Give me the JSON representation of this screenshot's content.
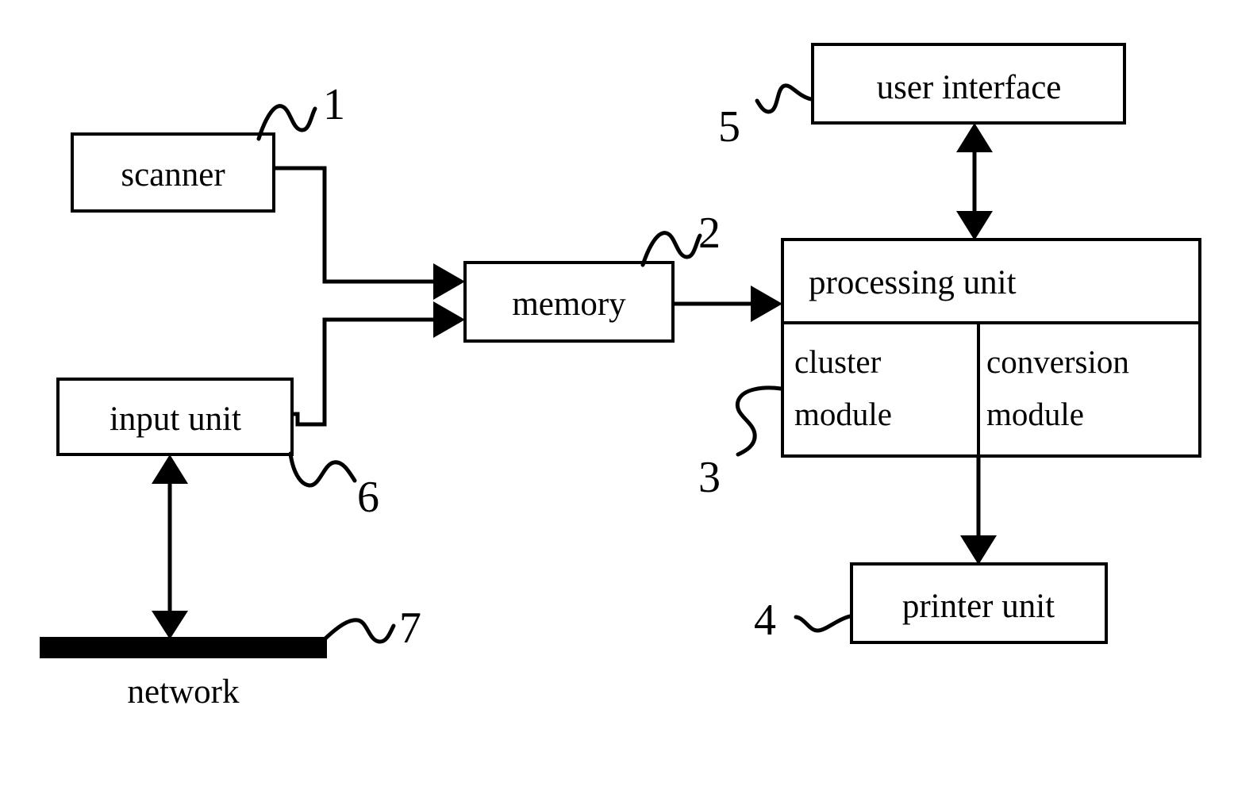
{
  "figure": {
    "type": "block-diagram",
    "title": "",
    "background_color": "#ffffff",
    "line_color": "#000000"
  },
  "blocks": {
    "scanner": {
      "label": "scanner",
      "ref": "1"
    },
    "memory": {
      "label": "memory",
      "ref": "2"
    },
    "input_unit": {
      "label": "input unit",
      "ref": "6"
    },
    "network": {
      "label": "network",
      "ref": "7"
    },
    "user_interface": {
      "label": "user interface",
      "ref": "5"
    },
    "processing_unit": {
      "label": "processing unit",
      "ref": ""
    },
    "cluster_module": {
      "label_line1": "cluster",
      "label_line2": "module",
      "ref": "3"
    },
    "conversion_module": {
      "label_line1": "conversion",
      "label_line2": "module",
      "ref": ""
    },
    "printer_unit": {
      "label": "printer unit",
      "ref": "4"
    }
  },
  "reference_numerals": [
    {
      "id": "1",
      "text": "1",
      "target": "scanner"
    },
    {
      "id": "2",
      "text": "2",
      "target": "memory"
    },
    {
      "id": "3",
      "text": "3",
      "target": "cluster-module"
    },
    {
      "id": "4",
      "text": "4",
      "target": "printer-unit"
    },
    {
      "id": "5",
      "text": "5",
      "target": "user-interface"
    },
    {
      "id": "6",
      "text": "6",
      "target": "input-unit"
    },
    {
      "id": "7",
      "text": "7",
      "target": "network"
    }
  ],
  "connections": [
    {
      "from": "scanner",
      "to": "memory",
      "style": "single-arrow"
    },
    {
      "from": "input unit",
      "to": "memory",
      "style": "single-arrow"
    },
    {
      "from": "memory",
      "to": "processing unit",
      "style": "single-arrow"
    },
    {
      "from": "user interface",
      "to": "processing unit",
      "style": "double-arrow"
    },
    {
      "from": "processing unit",
      "to": "printer unit",
      "style": "single-arrow"
    },
    {
      "from": "network",
      "to": "input unit",
      "style": "double-arrow"
    }
  ]
}
